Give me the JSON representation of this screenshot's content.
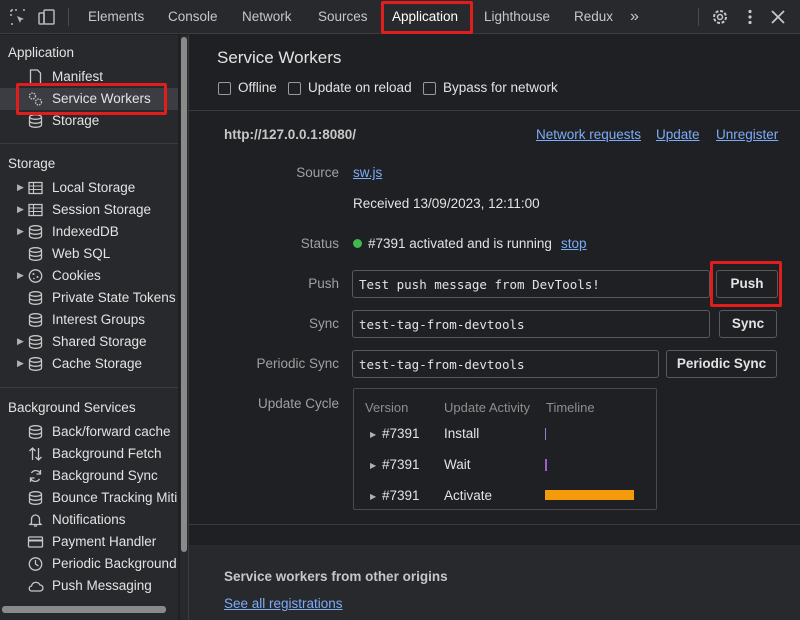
{
  "toolbar": {
    "tabs": [
      "Elements",
      "Console",
      "Network",
      "Sources",
      "Application",
      "Lighthouse",
      "Redux"
    ],
    "active_tab": "Application",
    "more": "»"
  },
  "sidebar": {
    "application_title": "Application",
    "application_items": [
      "Manifest",
      "Service Workers",
      "Storage"
    ],
    "selected_item": "Service Workers",
    "storage_title": "Storage",
    "storage_items": [
      "Local Storage",
      "Session Storage",
      "IndexedDB",
      "Web SQL",
      "Cookies",
      "Private State Tokens",
      "Interest Groups",
      "Shared Storage",
      "Cache Storage"
    ],
    "background_title": "Background Services",
    "background_items": [
      "Back/forward cache",
      "Background Fetch",
      "Background Sync",
      "Bounce Tracking Miti",
      "Notifications",
      "Payment Handler",
      "Periodic Background",
      "Push Messaging"
    ]
  },
  "main": {
    "title": "Service Workers",
    "checkboxes": [
      "Offline",
      "Update on reload",
      "Bypass for network"
    ],
    "origin": "http://127.0.0.1:8080/",
    "links": {
      "network_requests": "Network requests",
      "update": "Update",
      "unregister": "Unregister",
      "stop": "stop"
    },
    "source_label": "Source",
    "source_file": "sw.js",
    "received": "Received 13/09/2023, 12:11:00",
    "status_label": "Status",
    "status_text": "#7391 activated and is running",
    "status_color": "#3fb950",
    "push_label": "Push",
    "push_value": "Test push message from DevTools!",
    "push_button": "Push",
    "sync_label": "Sync",
    "sync_value": "test-tag-from-devtools",
    "sync_button": "Sync",
    "periodic_label": "Periodic Sync",
    "periodic_value": "test-tag-from-devtools",
    "periodic_button": "Periodic Sync",
    "cycle_label": "Update Cycle",
    "cycle_headers": [
      "Version",
      "Update Activity",
      "Timeline"
    ],
    "cycle_rows": [
      {
        "version": "#7391",
        "activity": "Install"
      },
      {
        "version": "#7391",
        "activity": "Wait"
      },
      {
        "version": "#7391",
        "activity": "Activate"
      }
    ],
    "timeline_colors": {
      "install": "#7c8cc8",
      "wait": "#a05cc8",
      "activate": "#f59a0b"
    },
    "other_origins_title": "Service workers from other origins",
    "see_all": "See all registrations"
  },
  "colors": {
    "highlight": "#e11d1d",
    "link": "#7cacf8",
    "accent_bar": "#f59a0b"
  }
}
